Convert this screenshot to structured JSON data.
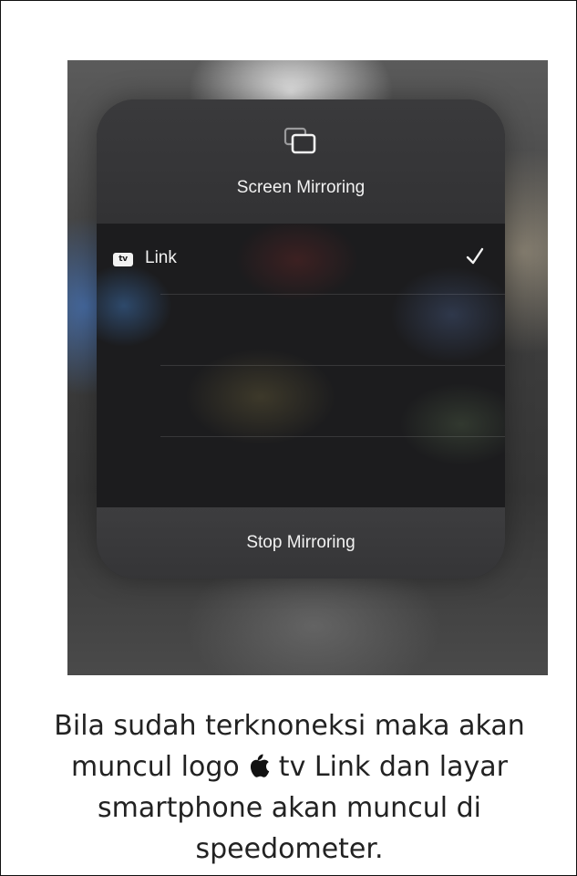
{
  "panel": {
    "title": "Screen Mirroring",
    "icon": "screen-mirroring-icon",
    "devices": [
      {
        "badge": "tv",
        "badge_icon": "apple-tv-icon",
        "name": "Link",
        "selected": true
      }
    ],
    "stop_label": "Stop Mirroring"
  },
  "caption": {
    "line1": "Bila sudah terknoneksi maka akan",
    "line2_before": "muncul logo ",
    "line2_after": " tv Link dan layar",
    "line3": "smartphone akan muncul di",
    "line4": "speedometer.",
    "logo_icon": "apple-logo-icon"
  },
  "colors": {
    "panel_bg": "#2d2d2f",
    "list_bg": "#1c1c1e",
    "text_light": "#f2f2f2",
    "caption_text": "#222222"
  }
}
